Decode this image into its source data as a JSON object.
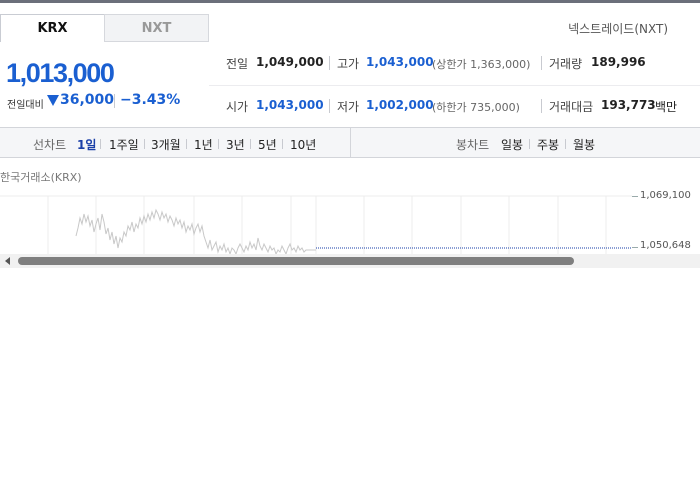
{
  "tabs": {
    "krx": "KRX",
    "nxt": "NXT"
  },
  "nxt_link": "넥스트레이드(NXT)",
  "price": {
    "current": "1,013,000",
    "change_label": "전일대비",
    "change_value": "36,000",
    "change_pct": "−3.43%",
    "direction": "down"
  },
  "stats": {
    "prev_close": {
      "label": "전일",
      "value": "1,049,000"
    },
    "high": {
      "label": "고가",
      "value": "1,043,000",
      "note": "(상한가 1,363,000)"
    },
    "volume": {
      "label": "거래량",
      "value": "189,996"
    },
    "open": {
      "label": "시가",
      "value": "1,043,000"
    },
    "low": {
      "label": "저가",
      "value": "1,002,000",
      "note": "(하한가 735,000)"
    },
    "amount": {
      "label": "거래대금",
      "value": "193,773",
      "unit": "백만"
    }
  },
  "range_bar": {
    "line_label": "선차트",
    "line_items": [
      "1일",
      "1주일",
      "3개월",
      "1년",
      "3년",
      "5년",
      "10년"
    ],
    "active_line_item": "1일",
    "candle_label": "봉차트",
    "candle_items": [
      "일봉",
      "주봉",
      "월봉"
    ]
  },
  "chart": {
    "title": "한국거래소(KRX)",
    "y_ticks": [
      "1,069,100",
      "1,050,648"
    ],
    "line_color": "#c8c8c8",
    "ref_line_color": "#1a3fa8"
  },
  "colors": {
    "down": "#1a5fd1",
    "accent": "#1a3fa8"
  }
}
